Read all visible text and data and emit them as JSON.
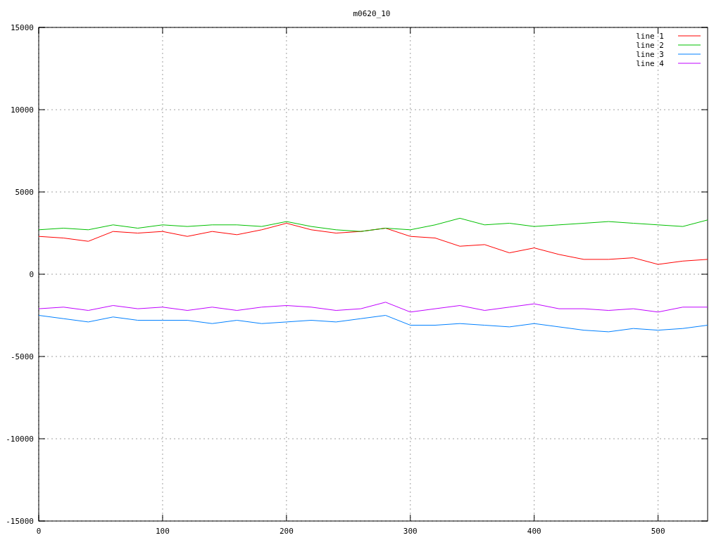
{
  "chart_data": {
    "type": "line",
    "title": "m0620_10",
    "grid": true,
    "legend": true,
    "xlim": [
      0,
      540
    ],
    "ylim": [
      -15000,
      15000
    ],
    "xticks": [
      0,
      100,
      200,
      300,
      400,
      500
    ],
    "yticks": [
      -15000,
      -10000,
      -5000,
      0,
      5000,
      10000,
      15000
    ],
    "x": [
      0,
      20,
      40,
      60,
      80,
      100,
      120,
      140,
      160,
      180,
      200,
      220,
      240,
      260,
      280,
      300,
      320,
      340,
      360,
      380,
      400,
      420,
      440,
      460,
      480,
      500,
      520,
      540
    ],
    "series": [
      {
        "name": "line 1",
        "color": "#ff0000",
        "values": [
          2300,
          2200,
          2000,
          2600,
          2500,
          2600,
          2300,
          2600,
          2400,
          2700,
          3100,
          2700,
          2500,
          2600,
          2800,
          2300,
          2200,
          1700,
          1800,
          1300,
          1600,
          1200,
          900,
          900,
          1000,
          600,
          800,
          900
        ]
      },
      {
        "name": "line 2",
        "color": "#00c000",
        "values": [
          2700,
          2800,
          2700,
          3000,
          2800,
          3000,
          2900,
          3000,
          3000,
          2900,
          3200,
          2900,
          2700,
          2600,
          2800,
          2700,
          3000,
          3400,
          3000,
          3100,
          2900,
          3000,
          3100,
          3200,
          3100,
          3000,
          2900,
          3300
        ]
      },
      {
        "name": "line 3",
        "color": "#0080ff",
        "values": [
          -2500,
          -2700,
          -2900,
          -2600,
          -2800,
          -2800,
          -2800,
          -3000,
          -2800,
          -3000,
          -2900,
          -2800,
          -2900,
          -2700,
          -2500,
          -3100,
          -3100,
          -3000,
          -3100,
          -3200,
          -3000,
          -3200,
          -3400,
          -3500,
          -3300,
          -3400,
          -3300,
          -3100
        ]
      },
      {
        "name": "line 4",
        "color": "#c000ff",
        "values": [
          -2100,
          -2000,
          -2200,
          -1900,
          -2100,
          -2000,
          -2200,
          -2000,
          -2200,
          -2000,
          -1900,
          -2000,
          -2200,
          -2100,
          -1700,
          -2300,
          -2100,
          -1900,
          -2200,
          -2000,
          -1800,
          -2100,
          -2100,
          -2200,
          -2100,
          -2300,
          -2000,
          -2000
        ]
      }
    ]
  }
}
